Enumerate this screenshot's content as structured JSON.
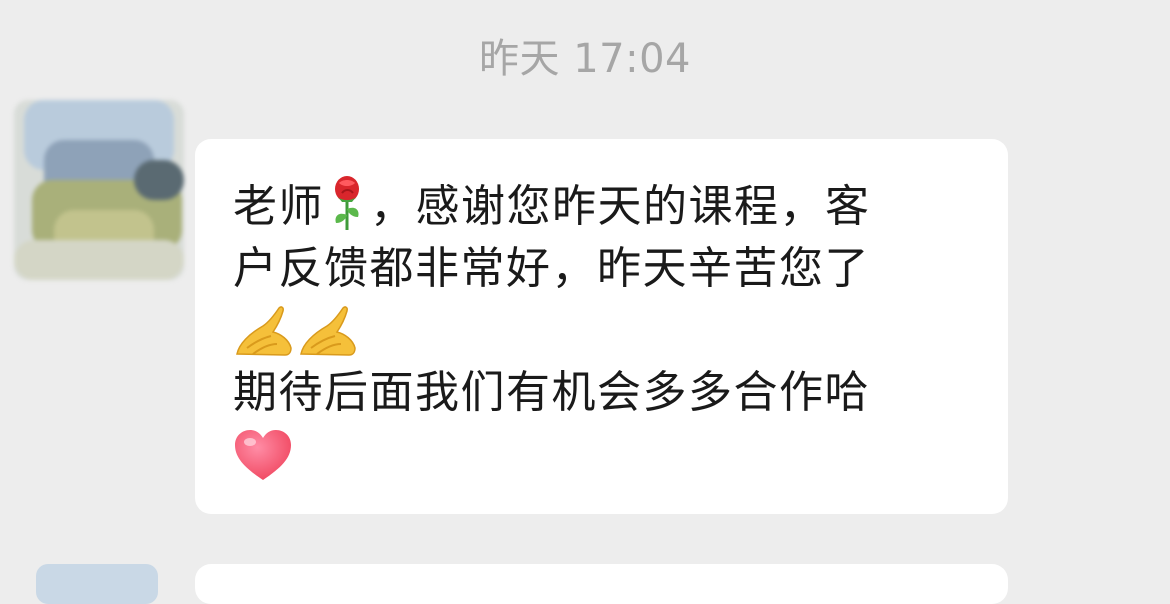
{
  "chat": {
    "timestamp": "昨天 17:04",
    "message": {
      "line1_part1": "老师",
      "line1_part2": "，感谢您昨天的课程，客",
      "line2": "户反馈都非常好，昨天辛苦您了",
      "line4": "期待后面我们有机会多多合作哈"
    }
  },
  "icons": {
    "rose": "rose-emoji",
    "pray": "folded-hands-emoji",
    "heart": "heart-emoji"
  }
}
